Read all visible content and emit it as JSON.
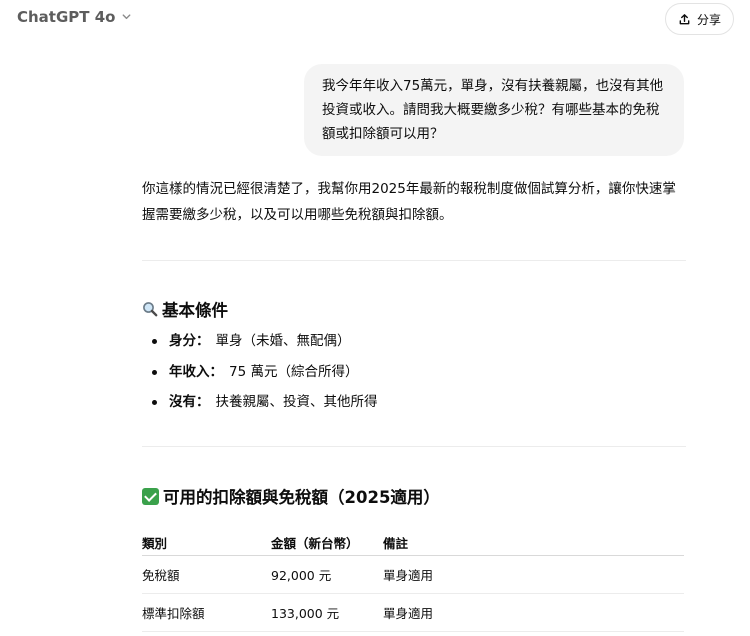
{
  "header": {
    "model_name": "ChatGPT 4o",
    "share_label": "分享"
  },
  "user_message": {
    "text": "我今年年收入75萬元，單身，沒有扶養親屬，也沒有其他投資或收入。請問我大概要繳多少稅？有哪些基本的免稅額或扣除額可以用？"
  },
  "assistant": {
    "intro": "你這樣的情況已經很清楚了，我幫你用2025年最新的報稅制度做個試算分析，讓你快速掌握需要繳多少稅，以及可以用哪些免稅額與扣除額。",
    "section1": {
      "title": "基本條件",
      "items": [
        {
          "key": "身分：",
          "value": "單身（未婚、無配偶）"
        },
        {
          "key": "年收入：",
          "value": "75 萬元（綜合所得）"
        },
        {
          "key": "沒有：",
          "value": "扶養親屬、投資、其他所得"
        }
      ]
    },
    "section2": {
      "title": "可用的扣除額與免稅額（2025適用）",
      "table": {
        "headers": [
          "類別",
          "金額（新台幣）",
          "備註"
        ],
        "rows": [
          [
            "免稅額",
            "92,000 元",
            "單身適用"
          ],
          [
            "標準扣除額",
            "133,000 元",
            "單身適用"
          ]
        ]
      }
    }
  },
  "icons": {
    "section1_icon": "magnifying-glass-icon",
    "section2_icon": "check-mark-icon",
    "share_icon": "share-upload-icon",
    "model_icon": "chevron-down-icon"
  },
  "colors": {
    "user_bubble_bg": "#f4f4f4",
    "check_green": "#3aa14b"
  }
}
